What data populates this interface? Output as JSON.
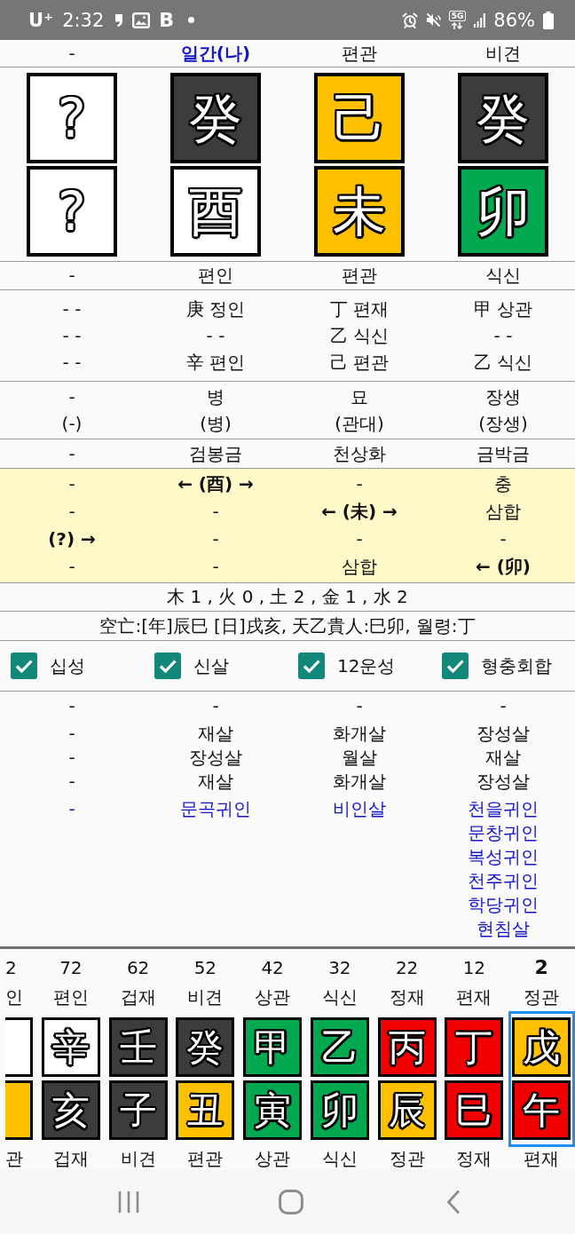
{
  "status_bar": {
    "carrier": "U⁺",
    "time": "2:32",
    "app_letter": "B",
    "network": "5G",
    "battery": "86%"
  },
  "pillars": {
    "top_labels": [
      {
        "label": "-",
        "kind": "plain"
      },
      {
        "label": "일간(나)",
        "kind": "self"
      },
      {
        "label": "편관",
        "kind": "plain"
      },
      {
        "label": "비견",
        "kind": "plain"
      }
    ],
    "stems": [
      {
        "char": "?",
        "color": "#ffffff"
      },
      {
        "char": "癸",
        "color": "#3c3c3c"
      },
      {
        "char": "己",
        "color": "#ffc000"
      },
      {
        "char": "癸",
        "color": "#3c3c3c"
      }
    ],
    "branches": [
      {
        "char": "?",
        "color": "#ffffff"
      },
      {
        "char": "酉",
        "color": "#ffffff"
      },
      {
        "char": "未",
        "color": "#ffc000"
      },
      {
        "char": "卯",
        "color": "#00a84f"
      }
    ],
    "bottom_labels": [
      "-",
      "편인",
      "편관",
      "식신"
    ],
    "hidden_stems": [
      [
        "- -",
        "- -",
        "- -"
      ],
      [
        "庚 정인",
        "- -",
        "辛 편인"
      ],
      [
        "丁 편재",
        "乙 식신",
        "己 편관"
      ],
      [
        "甲 상관",
        "- -",
        "乙 식신"
      ]
    ],
    "twelve_stages": [
      {
        "primary": "-",
        "secondary": "(-)"
      },
      {
        "primary": "병",
        "secondary": "(병)"
      },
      {
        "primary": "묘",
        "secondary": "(관대)"
      },
      {
        "primary": "장생",
        "secondary": "(장생)"
      }
    ],
    "nayin": [
      "-",
      "검봉금",
      "천상화",
      "금박금"
    ],
    "interactions": [
      [
        {
          "text": "-",
          "kind": "plain"
        },
        {
          "text": "-",
          "kind": "plain"
        },
        {
          "text": "(?) →",
          "kind": "pointer"
        },
        {
          "text": "-",
          "kind": "plain"
        }
      ],
      [
        {
          "text": "← (酉) →",
          "kind": "pointer"
        },
        {
          "text": "-",
          "kind": "plain"
        },
        {
          "text": "-",
          "kind": "plain"
        },
        {
          "text": "-",
          "kind": "plain"
        }
      ],
      [
        {
          "text": "-",
          "kind": "plain"
        },
        {
          "text": "← (未) →",
          "kind": "pointer"
        },
        {
          "text": "-",
          "kind": "plain"
        },
        {
          "text": "삼합",
          "kind": "plain"
        }
      ],
      [
        {
          "text": "충",
          "kind": "plain"
        },
        {
          "text": "삼합",
          "kind": "plain"
        },
        {
          "text": "-",
          "kind": "plain"
        },
        {
          "text": "← (卯)",
          "kind": "pointer"
        }
      ]
    ]
  },
  "element_counts": "木 1 , 火 0 , 土 2 , 金 1 , 水 2",
  "void_info": "空亡:[年]辰巳 [日]戌亥, 天乙貴人:巳卯, 월령:丁",
  "toggles": [
    {
      "label": "십성",
      "checked": true
    },
    {
      "label": "신살",
      "checked": true
    },
    {
      "label": "12운성",
      "checked": true
    },
    {
      "label": "형충회합",
      "checked": true
    }
  ],
  "spirits": [
    [
      {
        "text": "-",
        "kind": "plain"
      },
      {
        "text": "-",
        "kind": "plain"
      },
      {
        "text": "-",
        "kind": "plain"
      },
      {
        "text": "-",
        "kind": "plain"
      },
      {
        "text": "-",
        "kind": "noble"
      }
    ],
    [
      {
        "text": "-",
        "kind": "plain"
      },
      {
        "text": "재살",
        "kind": "plain"
      },
      {
        "text": "장성살",
        "kind": "plain"
      },
      {
        "text": "재살",
        "kind": "plain"
      },
      {
        "text": "문곡귀인",
        "kind": "noble"
      }
    ],
    [
      {
        "text": "-",
        "kind": "plain"
      },
      {
        "text": "화개살",
        "kind": "plain"
      },
      {
        "text": "월살",
        "kind": "plain"
      },
      {
        "text": "화개살",
        "kind": "plain"
      },
      {
        "text": "비인살",
        "kind": "noble"
      }
    ],
    [
      {
        "text": "-",
        "kind": "plain"
      },
      {
        "text": "장성살",
        "kind": "plain"
      },
      {
        "text": "재살",
        "kind": "plain"
      },
      {
        "text": "장성살",
        "kind": "plain"
      },
      {
        "text": "천을귀인",
        "kind": "noble"
      },
      {
        "text": "문창귀인",
        "kind": "noble"
      },
      {
        "text": "복성귀인",
        "kind": "noble"
      },
      {
        "text": "천주귀인",
        "kind": "noble"
      },
      {
        "text": "학당귀인",
        "kind": "noble"
      },
      {
        "text": "현침살",
        "kind": "noble"
      }
    ]
  ],
  "daewoon": [
    {
      "kind": "cut",
      "age": "2",
      "ten_god": "인",
      "stem": {
        "color": "#ffffff"
      },
      "branch": {
        "color": "#ffc000"
      },
      "branch_god": "관",
      "selected": false
    },
    {
      "kind": "full",
      "age": "72",
      "ten_god": "편인",
      "stem": {
        "char": "辛",
        "color": "#ffffff"
      },
      "branch": {
        "char": "亥",
        "color": "#3c3c3c"
      },
      "branch_god": "겁재",
      "selected": false
    },
    {
      "kind": "full",
      "age": "62",
      "ten_god": "겁재",
      "stem": {
        "char": "壬",
        "color": "#3c3c3c"
      },
      "branch": {
        "char": "子",
        "color": "#3c3c3c"
      },
      "branch_god": "비견",
      "selected": false
    },
    {
      "kind": "full",
      "age": "52",
      "ten_god": "비견",
      "stem": {
        "char": "癸",
        "color": "#3c3c3c"
      },
      "branch": {
        "char": "丑",
        "color": "#ffc000"
      },
      "branch_god": "편관",
      "selected": false
    },
    {
      "kind": "full",
      "age": "42",
      "ten_god": "상관",
      "stem": {
        "char": "甲",
        "color": "#00a84f"
      },
      "branch": {
        "char": "寅",
        "color": "#00a84f"
      },
      "branch_god": "상관",
      "selected": false
    },
    {
      "kind": "full",
      "age": "32",
      "ten_god": "식신",
      "stem": {
        "char": "乙",
        "color": "#00a84f"
      },
      "branch": {
        "char": "卯",
        "color": "#00a84f"
      },
      "branch_god": "식신",
      "selected": false
    },
    {
      "kind": "full",
      "age": "22",
      "ten_god": "정재",
      "stem": {
        "char": "丙",
        "color": "#f00000"
      },
      "branch": {
        "char": "辰",
        "color": "#ffc000"
      },
      "branch_god": "정관",
      "selected": false
    },
    {
      "kind": "full",
      "age": "12",
      "ten_god": "편재",
      "stem": {
        "char": "丁",
        "color": "#f00000"
      },
      "branch": {
        "char": "巳",
        "color": "#f00000"
      },
      "branch_god": "정재",
      "selected": false
    },
    {
      "kind": "full",
      "age": "2",
      "ten_god": "정관",
      "stem": {
        "char": "戊",
        "color": "#ffc000"
      },
      "branch": {
        "char": "午",
        "color": "#f00000"
      },
      "branch_god": "편재",
      "selected": true
    }
  ]
}
